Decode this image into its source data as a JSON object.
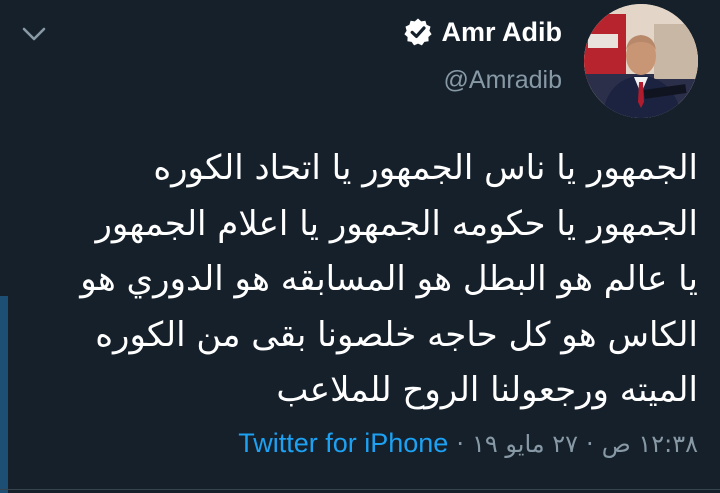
{
  "author": {
    "display_name": "Amr Adib",
    "handle": "@Amradib",
    "verified": true,
    "verified_icon": "verified-badge-icon"
  },
  "tweet": {
    "lines": [
      "الجمهور يا ناس الجمهور يا اتحاد الكوره",
      "الجمهور يا حكومه الجمهور يا اعلام الجمهور",
      "يا عالم هو البطل هو المسابقه هو الدوري هو",
      "الكاس هو كل حاجه خلصونا بقى من الكوره",
      "الميته ورجعولنا الروح للملاعب"
    ]
  },
  "meta": {
    "time": "١٢:٣٨ ص",
    "date": "٢٧ مايو ١٩",
    "separator": "·",
    "source": "Twitter for iPhone"
  },
  "colors": {
    "background": "#15202b",
    "text": "#ffffff",
    "secondary_text": "#8899a6",
    "link": "#1da1f2"
  },
  "icons": {
    "menu": "chevron-down-icon",
    "avatar": "profile-photo"
  }
}
